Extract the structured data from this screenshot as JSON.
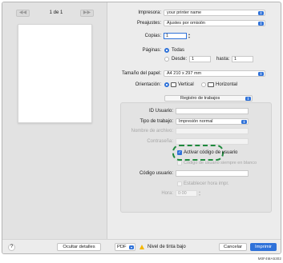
{
  "preview": {
    "prev_label": "◀◀",
    "next_label": "▶▶",
    "page_indicator": "1 de 1"
  },
  "printer": {
    "label": "Impresora:",
    "value": "your printer name"
  },
  "presets": {
    "label": "Preajustes:",
    "value": "Ajustes por omisión"
  },
  "copies": {
    "label": "Copias:",
    "value": "1"
  },
  "pages": {
    "label": "Páginas:",
    "all": "Todas",
    "from": "Desde:",
    "from_value": "1",
    "to": "hasta:",
    "to_value": "1",
    "selected": "all"
  },
  "paper_size": {
    "label": "Tamaño del papel:",
    "value": "A4 210 x 297 mm"
  },
  "orientation": {
    "label": "Orientación:",
    "vertical": "Vertical",
    "horizontal": "Horizontal",
    "selected": "vertical"
  },
  "section": {
    "selector": "Registro de trabajos",
    "user_id_label": "ID Usuario:",
    "user_id_value": "",
    "job_type_label": "Tipo de trabajo:",
    "job_type_value": "Impresión normal",
    "file_name_label": "Nombre de archivo:",
    "password_label": "Contraseña:",
    "enable_user_code": {
      "label": "Activar código de usuario",
      "checked": true
    },
    "always_use_user_code": {
      "label": "Código de usuario siempre en blanco",
      "checked": false
    },
    "user_code_label": "Código usuario:",
    "user_code_value": "",
    "set_print_time": {
      "label": "Establecer hora impr.",
      "checked": false
    },
    "time_label": "Hora:",
    "time_value": "0:00"
  },
  "bottom": {
    "help": "?",
    "hide_details": "Ocultar detalles",
    "pdf": "PDF",
    "low_ink": "Nivel de tinta bajo",
    "cancel": "Cancelar",
    "print": "Imprimir"
  },
  "footer_code": "M0F4MA5302",
  "colors": {
    "accent": "#2f72d9",
    "highlight": "#1e8a3c",
    "warning": "#f5b800"
  }
}
